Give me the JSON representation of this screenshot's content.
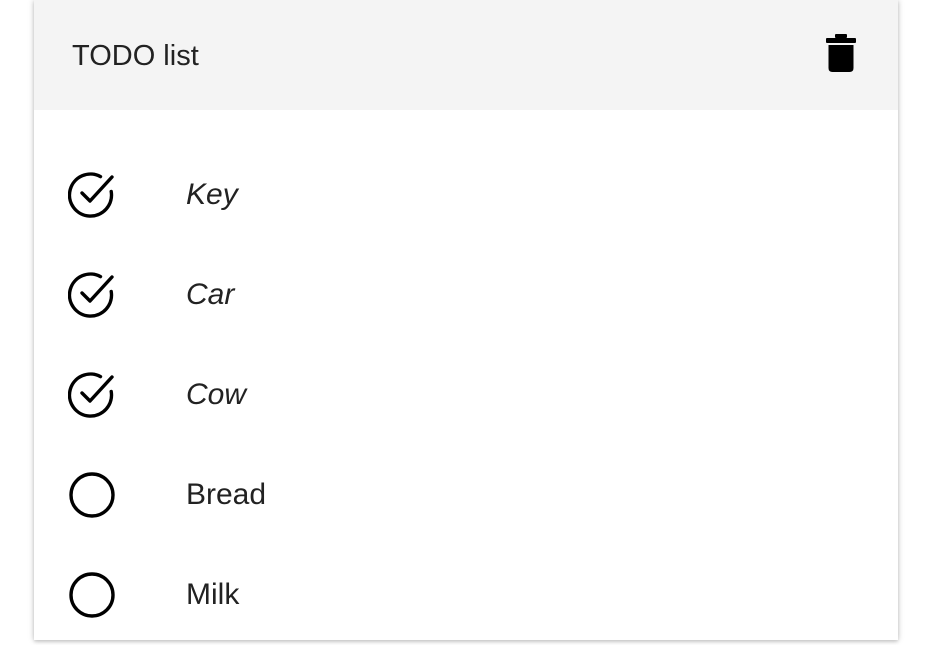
{
  "header": {
    "title": "TODO list",
    "delete_icon": "trash-icon"
  },
  "items": [
    {
      "label": "Key",
      "done": true
    },
    {
      "label": "Car",
      "done": true
    },
    {
      "label": "Cow",
      "done": true
    },
    {
      "label": "Bread",
      "done": false
    },
    {
      "label": "Milk",
      "done": false
    }
  ],
  "colors": {
    "header_bg": "#f4f4f4",
    "text": "#222222",
    "icon": "#000000"
  }
}
